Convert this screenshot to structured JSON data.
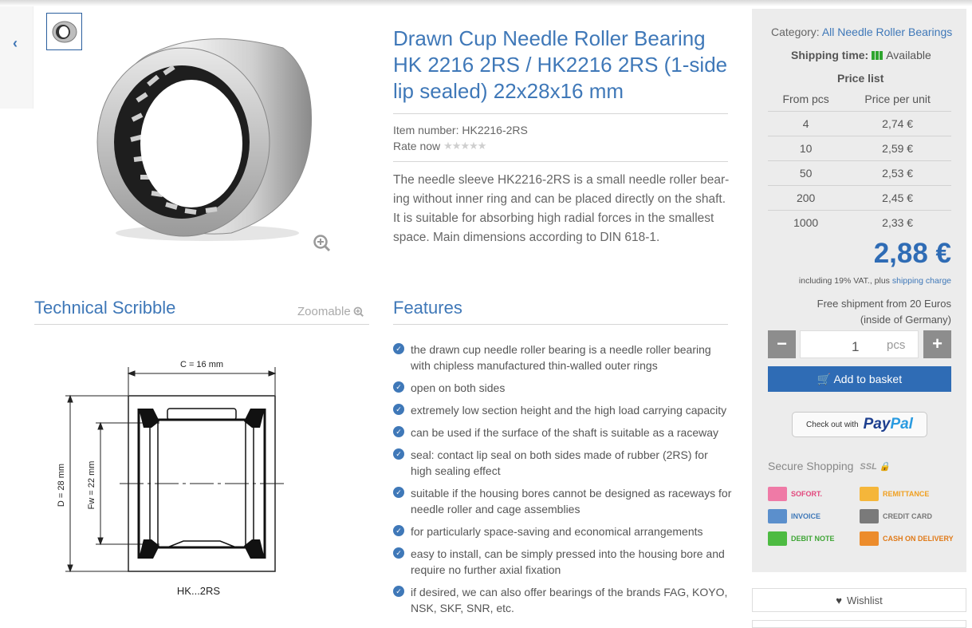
{
  "product": {
    "title": "Drawn Cup Needle Roller Bearing HK 2216 2RS / HK2216 2RS (1-side lip sealed) 22x28x16 mm",
    "item_number": "Item number: HK2216-2RS",
    "rate_label": "Rate now",
    "description": "The needle sleeve HK2216-2RS is a small needle roller bear-ing without inner ring and can be placed directly on the shaft. It is suitable for absorbing high radial forces in the smallest space. Main dimensions according to DIN 618-1."
  },
  "technical": {
    "heading": "Technical Scribble",
    "zoomable": "Zoomable",
    "dim_c": "C = 16 mm",
    "dim_d": "D = 28 mm",
    "dim_fw": "Fw = 22 mm",
    "caption": "HK...2RS"
  },
  "features": {
    "heading": "Features",
    "items": [
      "the drawn cup needle roller bearing is a needle roller bearing with chipless manufactured thin-walled outer rings",
      "open on both sides",
      "extremely low section height and the high load carrying capacity",
      "can be used if the surface of the shaft is suitable as a raceway",
      "seal: contact lip seal on both sides made of rubber (2RS) for high sealing effect",
      "suitable if the housing bores cannot be designed as raceways for needle roller and cage assemblies",
      "for particularly space-saving and economical arrangements",
      "easy to install, can be simply pressed into the housing bore and require no further axial fixation",
      "if desired, we can also offer bearings of the brands FAG, KOYO, NSK, SKF, SNR, etc."
    ]
  },
  "sidebar": {
    "category_label": "Category:",
    "category_link": "All Needle Roller Bearings",
    "shipping_label": "Shipping time:",
    "shipping_value": "Available",
    "price_list_title": "Price list",
    "col_from": "From pcs",
    "col_price": "Price per unit",
    "rows": [
      {
        "pcs": "4",
        "price": "2,74 €"
      },
      {
        "pcs": "10",
        "price": "2,59 €"
      },
      {
        "pcs": "50",
        "price": "2,53 €"
      },
      {
        "pcs": "200",
        "price": "2,45 €"
      },
      {
        "pcs": "1000",
        "price": "2,33 €"
      }
    ],
    "price": "2,88 €",
    "vat_text": "including 19% VAT., plus",
    "shipping_charge": "shipping charge",
    "free_line1": "Free shipment from 20 Euros",
    "free_line2": "(inside of Germany)",
    "minus": "−",
    "plus": "+",
    "quantity": "1",
    "unit": "pcs",
    "basket": "Add to basket",
    "paypal_checkout": "Check out with",
    "paypal_pay": "Pay",
    "paypal_pal": "Pal",
    "secure": "Secure Shopping",
    "ssl": "SSL",
    "payments": {
      "sofort": "SOFORT.",
      "remittance": "REMITTANCE",
      "invoice": "INVOICE",
      "credit_card": "CREDIT CARD",
      "debit_note": "DEBIT NOTE",
      "cod": "CASH ON DELIVERY"
    },
    "wishlist": "Wishlist"
  },
  "colors": {
    "accent": "#3f78b8",
    "button": "#2f6cb5",
    "available": "#2fa52f"
  }
}
